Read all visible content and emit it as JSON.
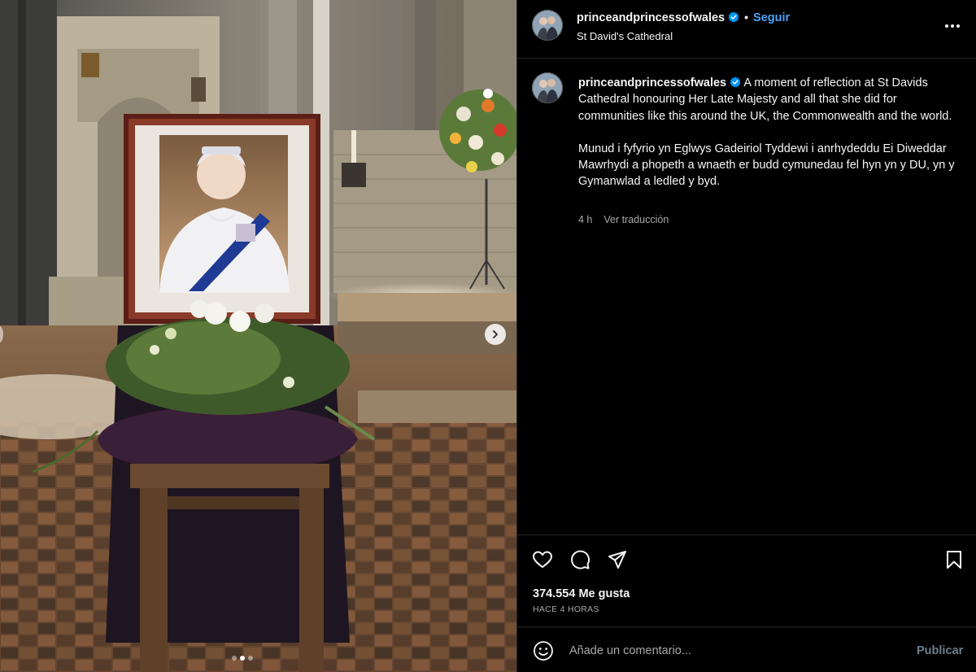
{
  "post": {
    "username": "princeandprincessofwales",
    "follow_label": "Seguir",
    "separator": "•",
    "location": "St David's Cathedral",
    "caption_en": "A moment of reflection at St Davids Cathedral honouring Her Late Majesty and all that she did for communities like this around the UK, the Commonwealth and the world.",
    "caption_cy": "Munud i fyfyrio yn Eglwys Gadeiriol Tyddewi i anrhydeddu Ei Diweddar Mawrhydi a phopeth a wnaeth er budd cymunedau fel hyn yn y DU, yn y Gymanwlad a ledled y byd.",
    "caption_time": "4 h",
    "translate_label": "Ver traducción",
    "likes_label": "374.554 Me gusta",
    "posted_ago": "HACE 4 HORAS"
  },
  "comment": {
    "placeholder": "Añade un comentario...",
    "publish_label": "Publicar"
  },
  "carousel": {
    "total_slides": 3,
    "active_slide": 2
  },
  "icons": {
    "header": [
      "verified-badge-icon",
      "more-options-icon"
    ],
    "actions": [
      "heart-icon",
      "comment-icon",
      "share-icon",
      "bookmark-icon"
    ],
    "comment": [
      "emoji-icon"
    ],
    "media": [
      "chevron-right-icon"
    ]
  },
  "colors": {
    "accent": "#0095f6",
    "follow": "#4aa3f5",
    "background": "#000000",
    "text": "#f5f5f5",
    "muted": "#a8a8a8"
  }
}
